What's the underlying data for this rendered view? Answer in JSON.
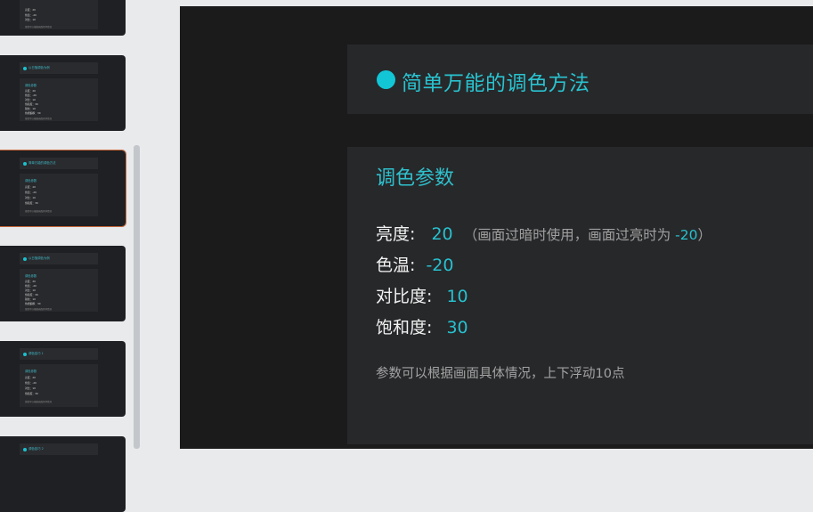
{
  "slide": {
    "title": "简单万能的调色方法",
    "card_title": "调色参数",
    "params": [
      {
        "label": "亮度:",
        "value": "20",
        "hint_open": "（画面过暗时使用，画面过亮时为 ",
        "hint_value": "-20",
        "hint_close": "）"
      },
      {
        "label": "色温:",
        "value": "-20"
      },
      {
        "label": "对比度:",
        "value": "10"
      },
      {
        "label": "饱和度:",
        "value": "30"
      }
    ],
    "note": "参数可以根据画面具体情况，上下浮动10点"
  },
  "thumbnails": [
    {
      "title": "",
      "card_title": "",
      "lines": [
        "亮度：20",
        "色温：-20",
        "对比：10",
        "饱和度：30"
      ],
      "note": "参数可以根据画面具体情况"
    },
    {
      "title": "以日落调色为例",
      "card_title": "调色参数",
      "lines": [
        "亮度：20",
        "色温：-20",
        "对比：10",
        "饱和度：30",
        "锐化：10",
        "色相偏移：30"
      ],
      "note": "参数可以根据画面具体情况"
    },
    {
      "title": "简单万能的调色方法",
      "card_title": "调色参数",
      "lines": [
        "亮度：20",
        "色温：-20",
        "对比：10",
        "饱和度：30"
      ],
      "note": "参数可以根据画面具体情况"
    },
    {
      "title": "以日落调色为例",
      "card_title": "调色参数",
      "lines": [
        "亮度：20",
        "色温：-20",
        "对比：10",
        "饱和度：30",
        "锐化：10",
        "色相偏移：30"
      ],
      "note": "参数可以根据画面具体情况"
    },
    {
      "title": "调色技巧 1",
      "card_title": "调色参数",
      "lines": [
        "亮度：20",
        "色温：-20",
        "对比：10",
        "饱和度：30"
      ],
      "note": "参数可以根据画面具体情况"
    },
    {
      "title": "调色技巧 2",
      "card_title": "",
      "lines": [],
      "note": ""
    }
  ]
}
